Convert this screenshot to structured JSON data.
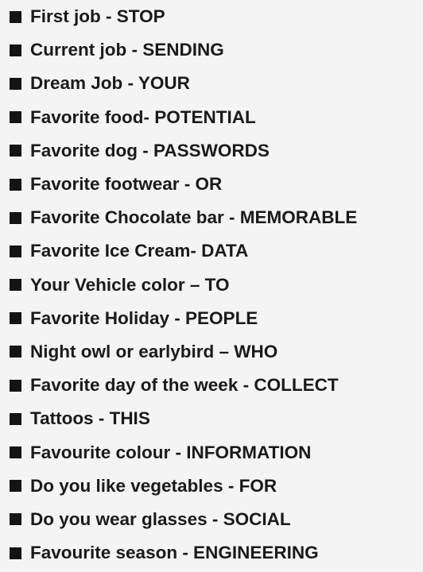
{
  "items": [
    {
      "label": "First job - STOP"
    },
    {
      "label": "Current job - SENDING"
    },
    {
      "label": "Dream Job - YOUR"
    },
    {
      "label": "Favorite food- POTENTIAL"
    },
    {
      "label": "Favorite dog - PASSWORDS"
    },
    {
      "label": "Favorite footwear - OR"
    },
    {
      "label": "Favorite Chocolate bar - MEMORABLE"
    },
    {
      "label": "Favorite Ice Cream- DATA"
    },
    {
      "label": "Your Vehicle color – TO"
    },
    {
      "label": "Favorite Holiday - PEOPLE"
    },
    {
      "label": "Night owl or earlybird – WHO"
    },
    {
      "label": "Favorite day of the week - COLLECT"
    },
    {
      "label": "Tattoos - THIS"
    },
    {
      "label": "Favourite colour - INFORMATION"
    },
    {
      "label": "Do you like vegetables - FOR"
    },
    {
      "label": "Do you wear glasses - SOCIAL"
    },
    {
      "label": "Favourite season - ENGINEERING"
    }
  ]
}
